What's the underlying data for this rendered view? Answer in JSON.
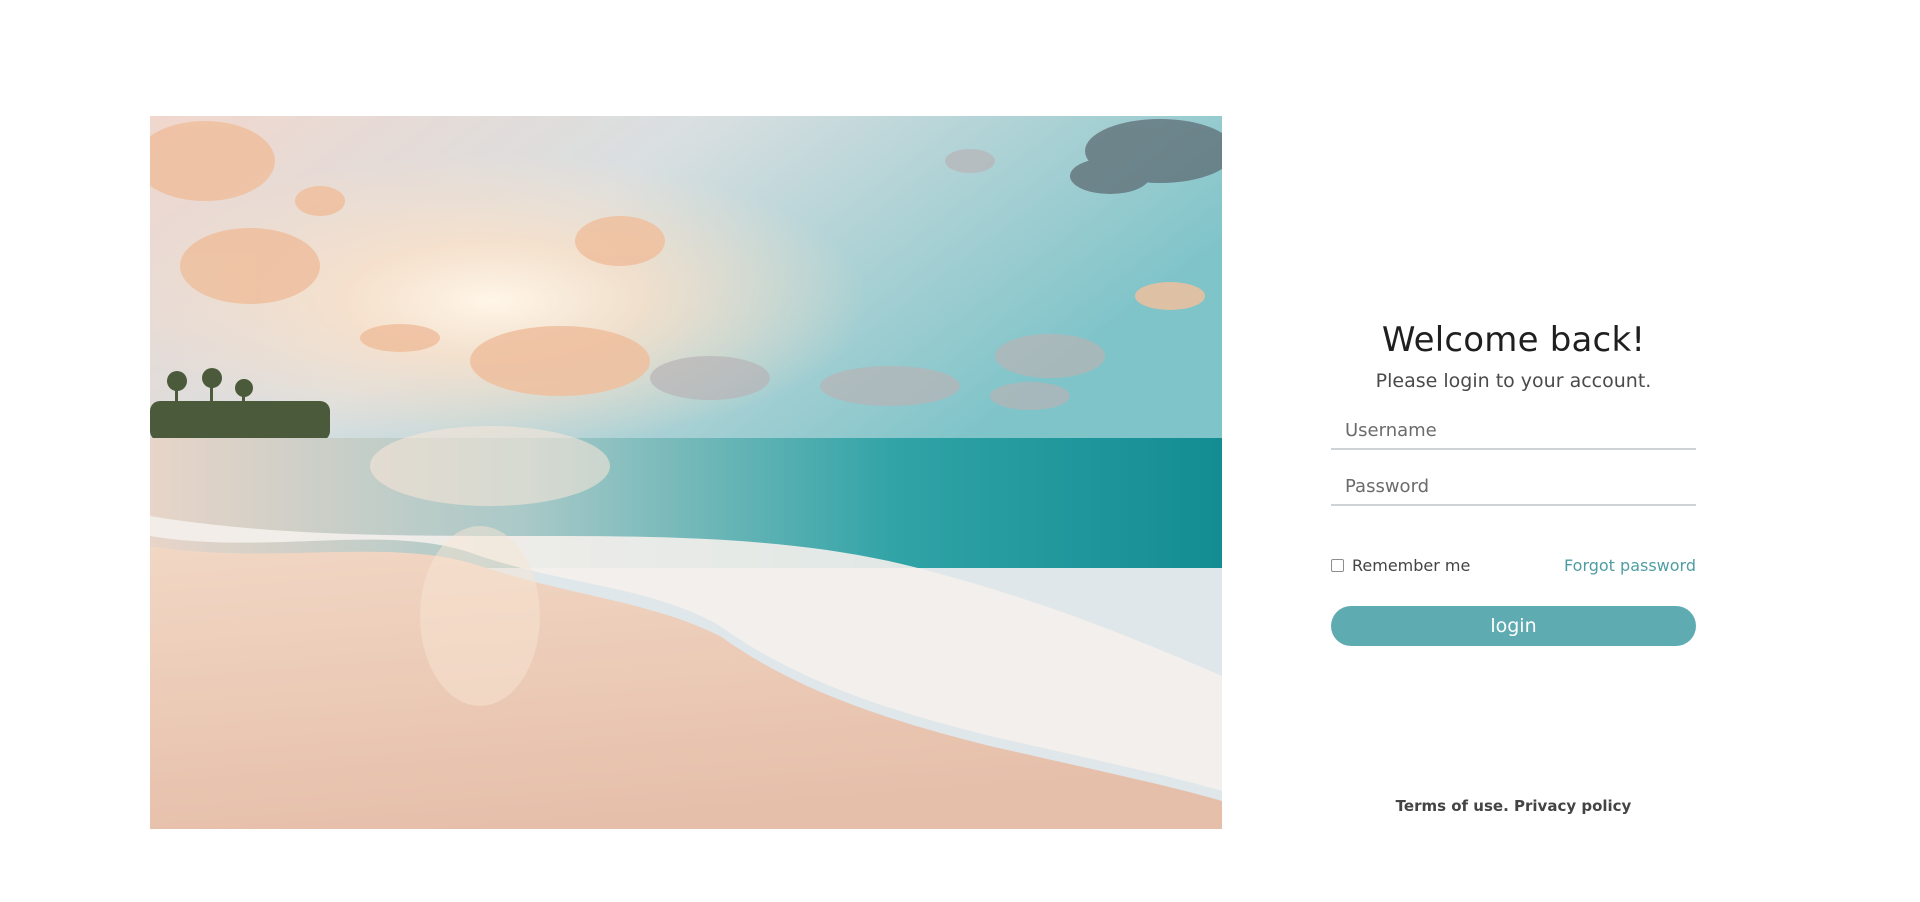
{
  "login": {
    "title": "Welcome back!",
    "subtitle": "Please login to your account.",
    "username_placeholder": "Username",
    "password_placeholder": "Password",
    "remember_label": "Remember me",
    "remember_checked": false,
    "forgot_label": "Forgot password",
    "submit_label": "login"
  },
  "footer": {
    "terms_label": "Terms of use.",
    "privacy_label": "Privacy policy"
  },
  "colors": {
    "accent": "#5fabb2",
    "link": "#4f9da3",
    "title": "#1f1f1f"
  }
}
